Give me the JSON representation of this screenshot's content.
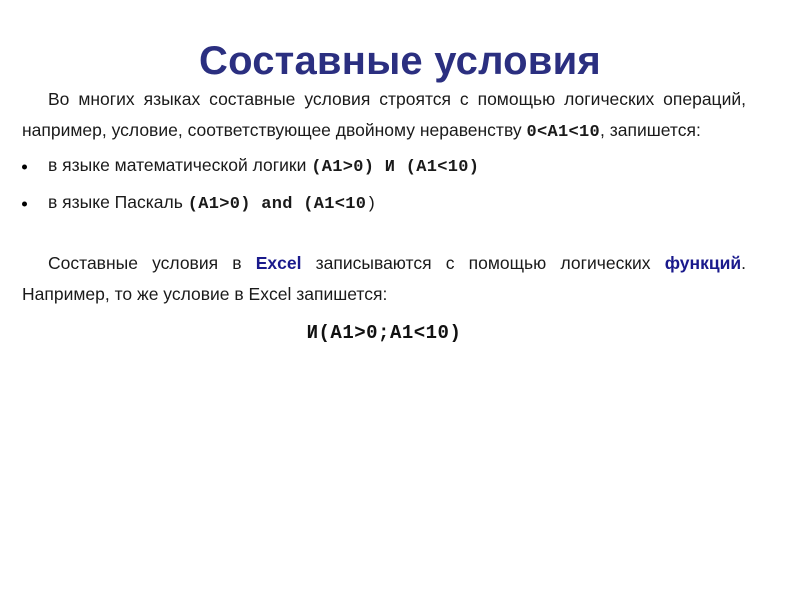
{
  "slide": {
    "title": "Составные условия",
    "title_color": "#2b2f80",
    "background_color": "#ffffff",
    "accent_color": "#1a1a8c"
  },
  "intro": {
    "seg1": "Во многих языках составные условия строятся с помощью логических операций, например, условие, соответствующее двойному неравенству ",
    "inequality": "0<A1<10",
    "seg2": ", запишется:"
  },
  "bullets": [
    {
      "text": "в языке математической логики ",
      "code": "(A1>0) И (A1<10)",
      "code_tail": ""
    },
    {
      "text": "в языке Паскаль  ",
      "code": "(A1>0) and (A1<10",
      "code_tail": ")"
    }
  ],
  "excel_para": {
    "seg1": "Составные условия в ",
    "bold1": "Excel",
    "seg2": " записываются с помощью логических ",
    "bold2": "функций",
    "seg3": ". Например, то же условие в Excel запишется:"
  },
  "final_formula": "И(A1>0;A1<10)"
}
